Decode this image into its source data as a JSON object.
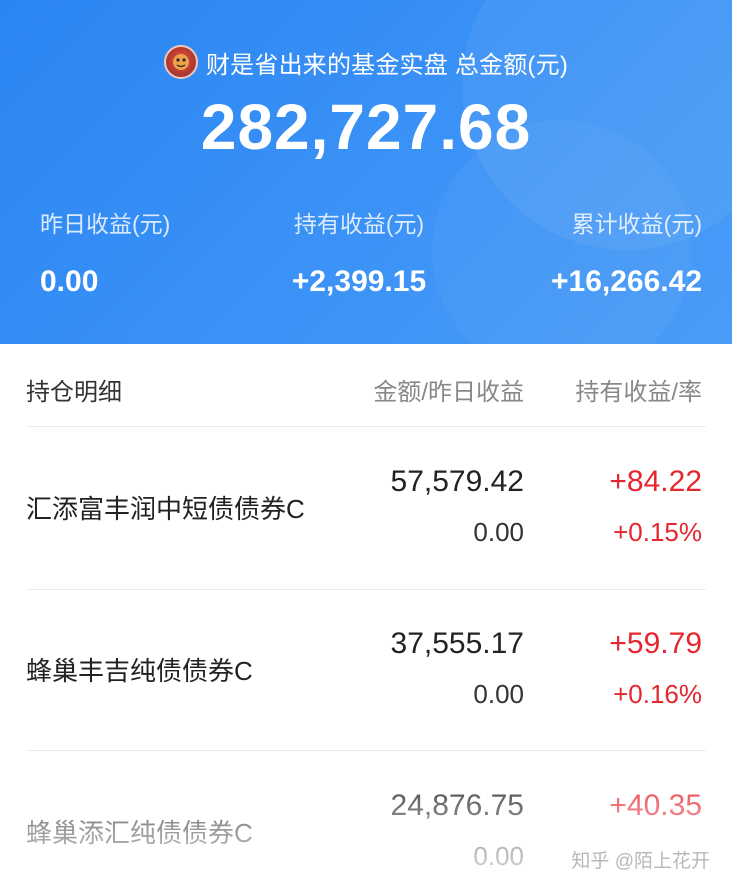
{
  "header": {
    "title": "财是省出来的基金实盘 总金额(元)",
    "avatar_icon": "avatar-icon",
    "total_amount": "282,727.68",
    "stats": {
      "yesterday_label": "昨日收益(元)",
      "yesterday_value": "0.00",
      "holding_label": "持有收益(元)",
      "holding_value": "+2,399.15",
      "cumulative_label": "累计收益(元)",
      "cumulative_value": "+16,266.42"
    }
  },
  "list": {
    "header": {
      "name": "持仓明细",
      "amount": "金额/昨日收益",
      "profit": "持有收益/率"
    },
    "rows": [
      {
        "name": "汇添富丰润中短债债券C",
        "amount": "57,579.42",
        "yesterday": "0.00",
        "profit": "+84.22",
        "rate": "+0.15%"
      },
      {
        "name": "蜂巢丰吉纯债债券C",
        "amount": "37,555.17",
        "yesterday": "0.00",
        "profit": "+59.79",
        "rate": "+0.16%"
      },
      {
        "name": "蜂巢添汇纯债债券C",
        "amount": "24,876.75",
        "yesterday": "0.00",
        "profit": "+40.35",
        "rate": ""
      }
    ]
  },
  "watermark": "知乎 @陌上花开",
  "colors": {
    "header_blue": "#2a86f3",
    "profit_red": "#e6262e",
    "text_dark": "#222222",
    "text_gray": "#888888"
  }
}
